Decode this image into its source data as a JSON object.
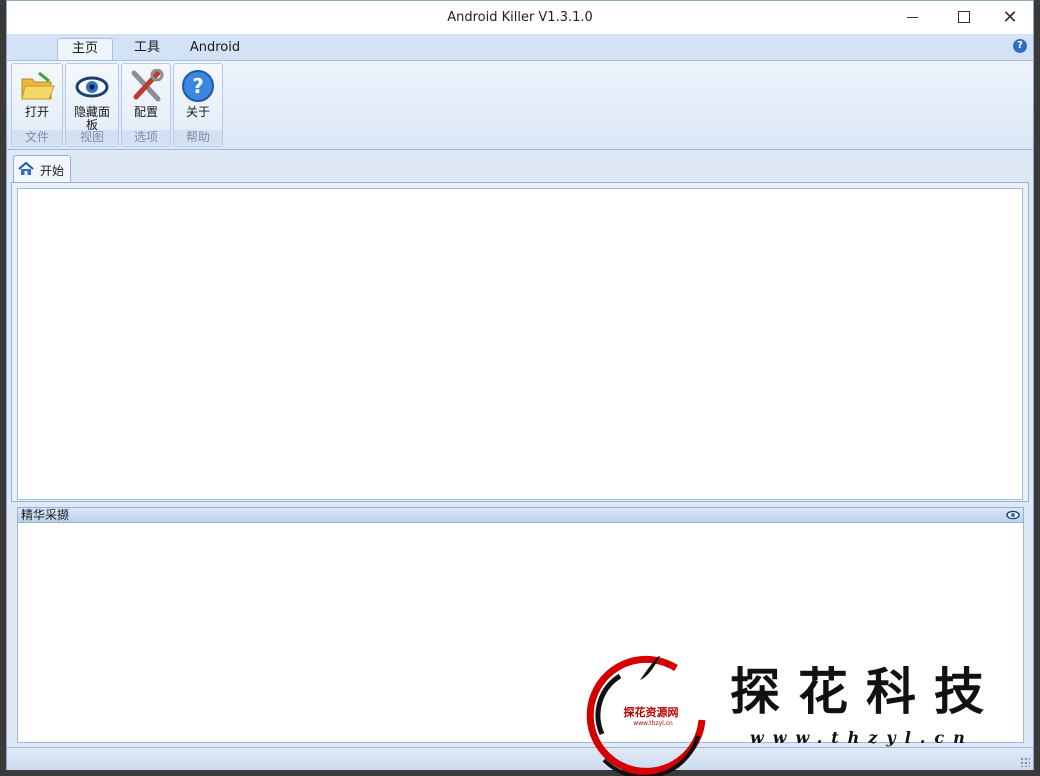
{
  "window": {
    "title": "Android Killer V1.3.1.0"
  },
  "ribbon": {
    "tabs": [
      {
        "label": "主页",
        "active": true
      },
      {
        "label": "工具",
        "active": false
      },
      {
        "label": "Android",
        "active": false
      }
    ],
    "groups": [
      {
        "button": "打开",
        "group": "文件",
        "icon": "open-folder-icon"
      },
      {
        "button": "隐藏面板",
        "group": "视图",
        "icon": "eye-icon"
      },
      {
        "button": "配置",
        "group": "选项",
        "icon": "tools-icon"
      },
      {
        "button": "关于",
        "group": "帮助",
        "icon": "help-icon"
      }
    ]
  },
  "doc_tab": {
    "label": "开始",
    "icon": "home-icon"
  },
  "panel": {
    "title": "精华采撷"
  },
  "watermark": {
    "brand": "探花科技",
    "url": "www.thzyl.cn",
    "seal_text": "探花资源网",
    "seal_url": "www.thzyl.cn"
  },
  "colors": {
    "accent": "#2f6fc4",
    "ribbon_bg": "#dfe9f5",
    "watermark_red": "#d40000"
  }
}
